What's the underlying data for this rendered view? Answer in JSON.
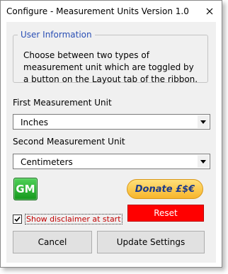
{
  "window": {
    "title": "Configure - Measurement Units Version 1.0"
  },
  "user_info": {
    "legend": "User Information",
    "text": "Choose between two types of measurement unit which are toggled by a button on the Layout tab of the ribbon."
  },
  "first_unit": {
    "label": "First Measurement Unit",
    "value": "Inches"
  },
  "second_unit": {
    "label": "Second Measurement Unit",
    "value": "Centimeters"
  },
  "gm_button": {
    "label": "GM"
  },
  "donate_button": {
    "label": "Donate £$€"
  },
  "reset_button": {
    "label": "Reset",
    "color": "#ff0000"
  },
  "disclaimer": {
    "label": "Show disclaimer at start",
    "checked": true,
    "color": "#c00000"
  },
  "footer": {
    "cancel_label": "Cancel",
    "update_label": "Update Settings"
  },
  "icons": {
    "close": "close-icon",
    "dropdown": "chevron-down-icon",
    "check": "checkmark-icon"
  }
}
